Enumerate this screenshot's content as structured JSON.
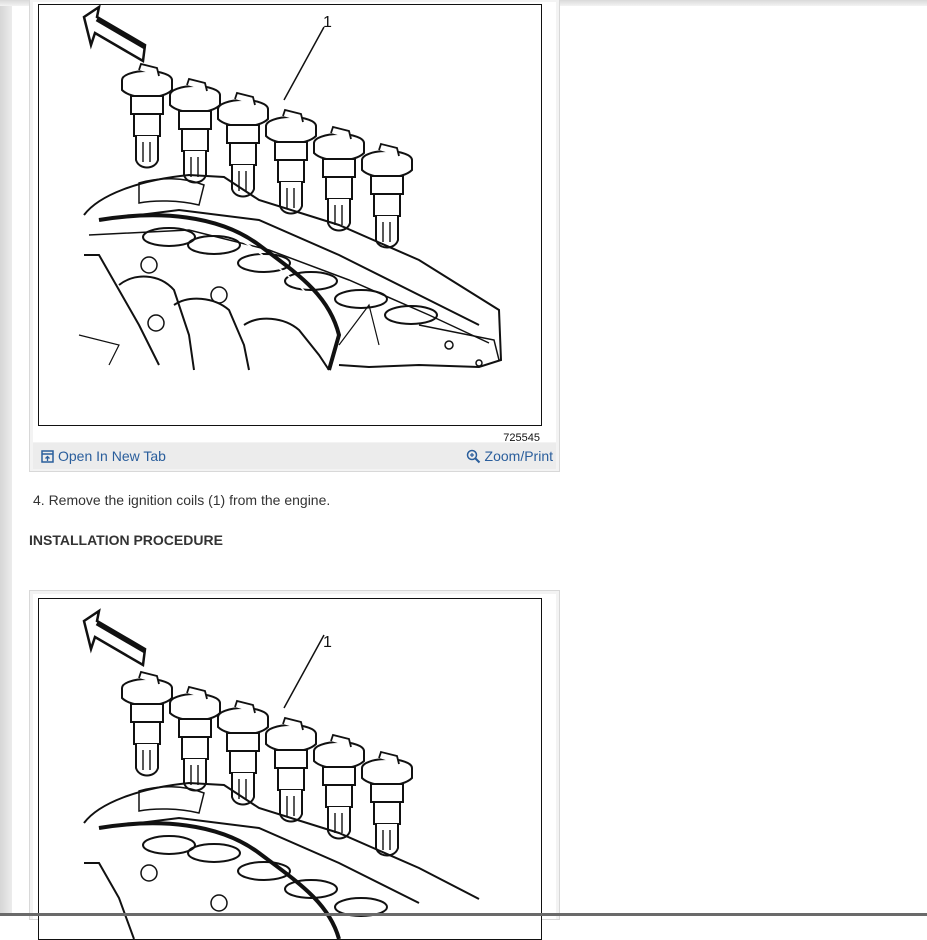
{
  "figures": [
    {
      "callout": "1",
      "code": "725545",
      "open_tab_label": "Open In New Tab",
      "zoom_label": "Zoom/Print",
      "open_tab_icon": "open-in-new-tab-icon",
      "zoom_icon": "zoom-in-icon"
    },
    {
      "callout": "1"
    }
  ],
  "steps": {
    "step4": "4. Remove the ignition coils (1) from the engine."
  },
  "sections": {
    "installation": "INSTALLATION PROCEDURE"
  },
  "colors": {
    "link": "#2a5e9c",
    "footer_bg": "#ececec",
    "text": "#333333"
  }
}
